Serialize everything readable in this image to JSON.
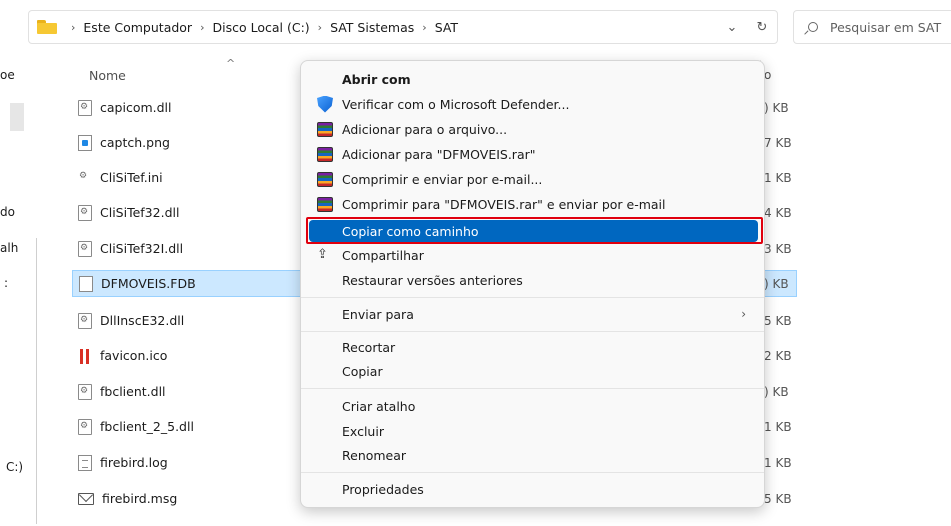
{
  "address": {
    "crumbs": [
      "Este Computador",
      "Disco Local (C:)",
      "SAT Sistemas",
      "SAT"
    ],
    "dropdown_icon": "chevron-down-icon",
    "refresh_icon": "refresh-icon"
  },
  "search": {
    "placeholder": "Pesquisar em SAT"
  },
  "nav": {
    "frag1": "oe",
    "frag2": "do",
    "frag3": "alh",
    "frag4": ":",
    "frag5": "C:)"
  },
  "list": {
    "header_name": "Nome",
    "header_size_frag": "o",
    "files": [
      {
        "name": "capicom.dll",
        "size_frag": ") KB"
      },
      {
        "name": "captch.png",
        "size_frag": "7 KB"
      },
      {
        "name": "CliSiTef.ini",
        "size_frag": "1 KB"
      },
      {
        "name": "CliSiTef32.dll",
        "size_frag": "4 KB"
      },
      {
        "name": "CliSiTef32I.dll",
        "size_frag": "3 KB"
      },
      {
        "name": "DFMOVEIS.FDB",
        "size_frag": ") KB"
      },
      {
        "name": "DllInscE32.dll",
        "size_frag": "5 KB"
      },
      {
        "name": "favicon.ico",
        "size_frag": "2 KB"
      },
      {
        "name": "fbclient.dll",
        "size_frag": ") KB"
      },
      {
        "name": "fbclient_2_5.dll",
        "size_frag": "1 KB"
      },
      {
        "name": "firebird.log",
        "size_frag": "1 KB"
      },
      {
        "name": "firebird.msg",
        "size_frag": "5 KB"
      }
    ]
  },
  "menu": {
    "open_with": "Abrir com",
    "defender": "Verificar com o Microsoft Defender...",
    "add_archive": "Adicionar para o arquivo...",
    "add_rar": "Adicionar para \"DFMOVEIS.rar\"",
    "compress_email": "Comprimir e enviar por e-mail...",
    "compress_rar_email": "Comprimir para \"DFMOVEIS.rar\" e enviar por e-mail",
    "copy_path": "Copiar como caminho",
    "share": "Compartilhar",
    "restore": "Restaurar versões anteriores",
    "send_to": "Enviar para",
    "cut": "Recortar",
    "copy": "Copiar",
    "create_shortcut": "Criar atalho",
    "delete": "Excluir",
    "rename": "Renomear",
    "properties": "Propriedades"
  }
}
